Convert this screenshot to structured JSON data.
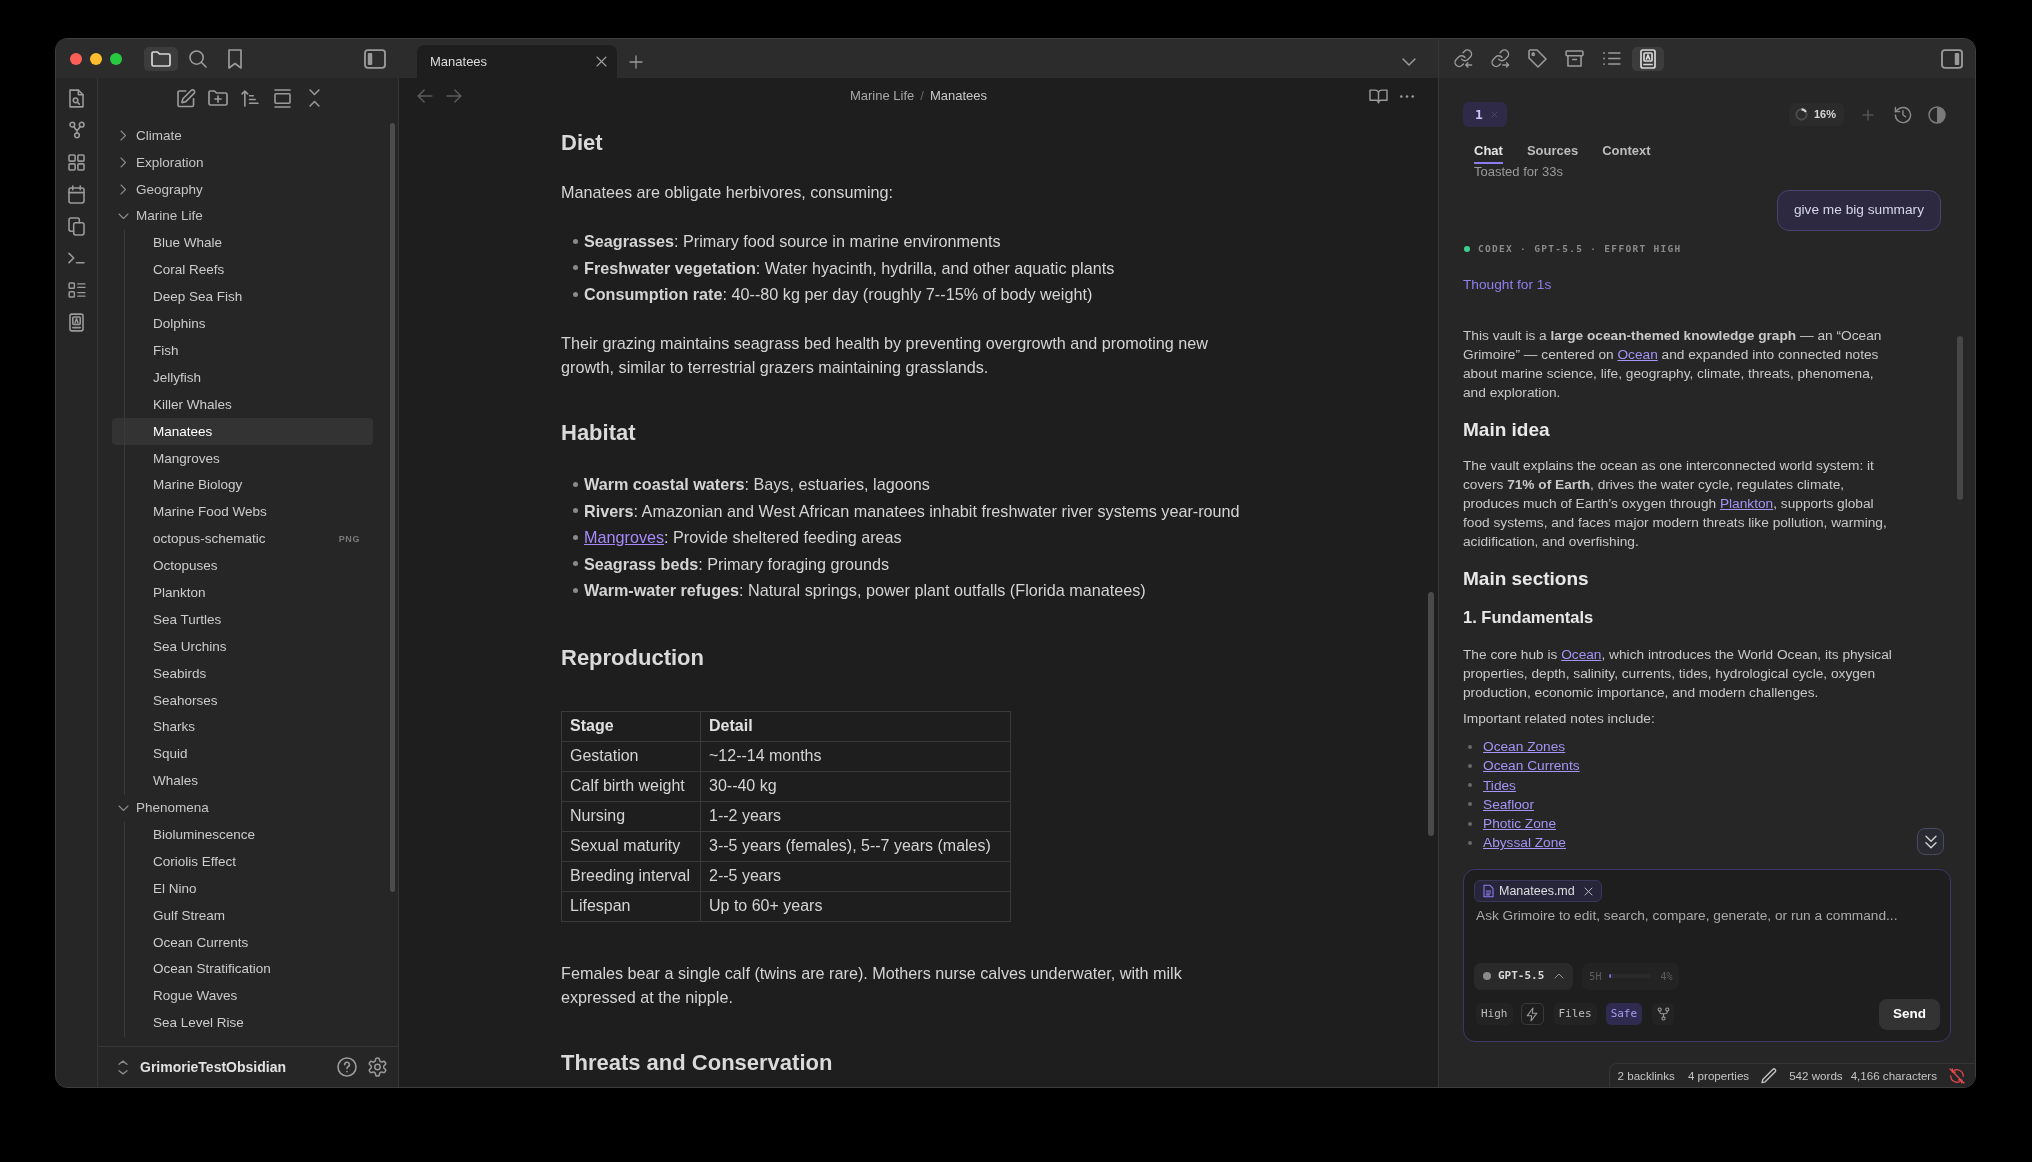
{
  "sidebar_header": {
    "view_tabs": [
      {
        "selected": true
      },
      {
        "selected": false
      },
      {
        "selected": false
      }
    ]
  },
  "file_tree": {
    "items": [
      {
        "label": "Climate",
        "kind": "folder",
        "expanded": false,
        "selected": false
      },
      {
        "label": "Exploration",
        "kind": "folder",
        "expanded": false,
        "selected": false
      },
      {
        "label": "Geography",
        "kind": "folder",
        "expanded": false,
        "selected": false
      },
      {
        "label": "Marine Life",
        "kind": "folder",
        "expanded": true,
        "selected": false,
        "children": [
          {
            "label": "Blue Whale",
            "kind": "file",
            "selected": false
          },
          {
            "label": "Coral Reefs",
            "kind": "file",
            "selected": false
          },
          {
            "label": "Deep Sea Fish",
            "kind": "file",
            "selected": false
          },
          {
            "label": "Dolphins",
            "kind": "file",
            "selected": false
          },
          {
            "label": "Fish",
            "kind": "file",
            "selected": false
          },
          {
            "label": "Jellyfish",
            "kind": "file",
            "selected": false
          },
          {
            "label": "Killer Whales",
            "kind": "file",
            "selected": false
          },
          {
            "label": "Manatees",
            "kind": "file",
            "selected": true
          },
          {
            "label": "Mangroves",
            "kind": "file",
            "selected": false
          },
          {
            "label": "Marine Biology",
            "kind": "file",
            "selected": false
          },
          {
            "label": "Marine Food Webs",
            "kind": "file",
            "selected": false
          },
          {
            "label": "octopus-schematic",
            "kind": "file",
            "selected": false,
            "badge": "PNG"
          },
          {
            "label": "Octopuses",
            "kind": "file",
            "selected": false
          },
          {
            "label": "Plankton",
            "kind": "file",
            "selected": false
          },
          {
            "label": "Sea Turtles",
            "kind": "file",
            "selected": false
          },
          {
            "label": "Sea Urchins",
            "kind": "file",
            "selected": false
          },
          {
            "label": "Seabirds",
            "kind": "file",
            "selected": false
          },
          {
            "label": "Seahorses",
            "kind": "file",
            "selected": false
          },
          {
            "label": "Sharks",
            "kind": "file",
            "selected": false
          },
          {
            "label": "Squid",
            "kind": "file",
            "selected": false
          },
          {
            "label": "Whales",
            "kind": "file",
            "selected": false
          }
        ]
      },
      {
        "label": "Phenomena",
        "kind": "folder",
        "expanded": true,
        "selected": false,
        "children": [
          {
            "label": "Bioluminescence",
            "kind": "file",
            "selected": false
          },
          {
            "label": "Coriolis Effect",
            "kind": "file",
            "selected": false
          },
          {
            "label": "El Nino",
            "kind": "file",
            "selected": false
          },
          {
            "label": "Gulf Stream",
            "kind": "file",
            "selected": false
          },
          {
            "label": "Ocean Currents",
            "kind": "file",
            "selected": false
          },
          {
            "label": "Ocean Stratification",
            "kind": "file",
            "selected": false
          },
          {
            "label": "Rogue Waves",
            "kind": "file",
            "selected": false
          },
          {
            "label": "Sea Level Rise",
            "kind": "file",
            "selected": false
          }
        ]
      }
    ]
  },
  "vault": {
    "name": "GrimorieTestObsidian"
  },
  "tab_bar": {
    "tabs": [
      {
        "label": "Manatees",
        "selected": true
      }
    ]
  },
  "breadcrumb": {
    "folder": "Marine Life",
    "separator": "/",
    "note": "Manatees"
  },
  "note": {
    "blocks": [
      {
        "kind": "heading",
        "text": "Diet"
      },
      {
        "kind": "paragraph",
        "text": "Manatees are obligate herbivores, consuming:"
      },
      {
        "kind": "list",
        "items": [
          {
            "text": "**Seagrasses**: Primary food source in marine environments"
          },
          {
            "text": "**Freshwater vegetation**: Water hyacinth, hydrilla, and other aquatic plants"
          },
          {
            "text": "**Consumption rate**: 40--80 kg per day (roughly 7--15% of body weight)"
          }
        ]
      },
      {
        "kind": "paragraph",
        "text": "Their grazing maintains seagrass bed health by preventing overgrowth and promoting new growth, similar to terrestrial grazers maintaining grasslands."
      },
      {
        "kind": "heading",
        "text": "Habitat"
      },
      {
        "kind": "list",
        "items": [
          {
            "text": "**Warm coastal waters**: Bays, estuaries, lagoons"
          },
          {
            "text": "**Rivers**: Amazonian and West African manatees inhabit freshwater river systems year-round"
          },
          {
            "parts": [
              {
                "link": "Mangroves"
              },
              {
                "text": ": Provide sheltered feeding areas"
              }
            ]
          },
          {
            "text": "**Seagrass beds**: Primary foraging grounds"
          },
          {
            "text": "**Warm-water refuges**: Natural springs, power plant outfalls (Florida manatees)"
          }
        ]
      },
      {
        "kind": "heading",
        "text": "Reproduction"
      },
      {
        "kind": "table",
        "columns": [
          "Stage",
          "Detail"
        ],
        "rows": [
          [
            "Gestation",
            "~12--14 months"
          ],
          [
            "Calf birth weight",
            "30--40 kg"
          ],
          [
            "Nursing",
            "1--2 years"
          ],
          [
            "Sexual maturity",
            "3--5 years (females), 5--7 years (males)"
          ],
          [
            "Breeding interval",
            "2--5 years"
          ],
          [
            "Lifespan",
            "Up to 60+ years"
          ]
        ]
      },
      {
        "kind": "paragraph",
        "text": "Females bear a single calf (twins are rare). Mothers nurse calves underwater, with milk expressed at the nipple."
      },
      {
        "kind": "heading",
        "text": "Threats and Conservation"
      }
    ]
  },
  "right_header": {
    "view_tabs": [
      {
        "selected": false
      },
      {
        "selected": false
      },
      {
        "selected": false
      },
      {
        "selected": false
      },
      {
        "selected": false
      },
      {
        "selected": true
      }
    ]
  },
  "assistant": {
    "sessions": [
      {
        "label": "1",
        "selected": true
      }
    ],
    "context": {
      "label": "16%",
      "level": 0.16
    },
    "tabs": [
      {
        "label": "Chat",
        "selected": true
      },
      {
        "label": "Sources",
        "selected": false
      },
      {
        "label": "Context",
        "selected": false
      }
    ],
    "chat": [
      {
        "kind": "status",
        "text": "Toasted for 33s"
      },
      {
        "kind": "user",
        "text": "give me big summary"
      },
      {
        "kind": "meta",
        "text": "CODEX · GPT-5.5 · EFFORT HIGH"
      },
      {
        "kind": "thought",
        "text": "Thought for 1s"
      },
      {
        "kind": "paragraph",
        "parts": [
          {
            "text": "This vault is a **large ocean-themed knowledge graph** — an “Ocean Grimoire” — centered on "
          },
          {
            "link": "Ocean"
          },
          {
            "text": " and expanded into connected notes about marine science, life, geography, climate, threats, phenomena, and exploration."
          }
        ]
      },
      {
        "kind": "heading",
        "text": "Main idea"
      },
      {
        "kind": "paragraph",
        "parts": [
          {
            "text": "The vault explains the ocean as one interconnected world system: it covers **71% of Earth**, drives the water cycle, regulates climate, produces much of Earth’s oxygen through "
          },
          {
            "link": "Plankton"
          },
          {
            "text": ", supports global food systems, and faces major modern threats like pollution, warming, acidification, and overfishing."
          }
        ]
      },
      {
        "kind": "heading",
        "text": "Main sections"
      },
      {
        "kind": "subheading",
        "text": "1. Fundamentals"
      },
      {
        "kind": "paragraph",
        "parts": [
          {
            "text": "The core hub is "
          },
          {
            "link": "Ocean"
          },
          {
            "text": ", which introduces the World Ocean, its physical properties, depth, salinity, currents, tides, hydrological cycle, oxygen production, economic importance, and modern challenges."
          }
        ]
      },
      {
        "kind": "paragraph",
        "text": "Important related notes include:"
      },
      {
        "kind": "link_list",
        "items": [
          "Ocean Zones",
          "Ocean Currents",
          "Tides",
          "Seafloor",
          "Photic Zone",
          "Abyssal Zone"
        ]
      }
    ]
  },
  "composer": {
    "attachments": [
      {
        "label": "Manatees.md"
      }
    ],
    "placeholder": "Ask Grimoire to edit, search, compare, generate, or run a command...",
    "model": "GPT-5.5",
    "usage": {
      "label": "5H",
      "level": 0.04,
      "reading": "4%"
    },
    "effort": "High",
    "files": "Files",
    "mode": {
      "label": "Safe",
      "on": true
    },
    "send": "Send"
  },
  "status_bar": {
    "backlinks": "2 backlinks",
    "properties": "4 properties",
    "words": "542 words",
    "characters": "4,166 characters"
  }
}
